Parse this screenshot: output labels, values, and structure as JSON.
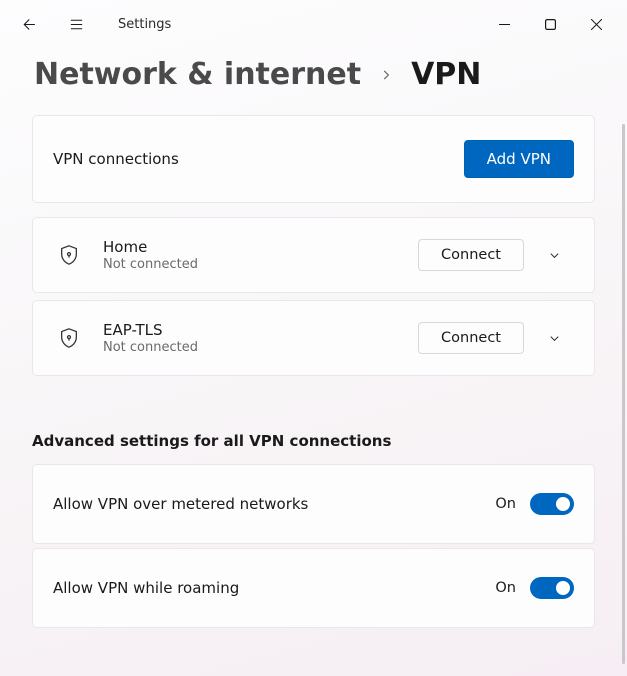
{
  "titlebar": {
    "title": "Settings"
  },
  "breadcrumb": {
    "parent": "Network & internet",
    "current": "VPN"
  },
  "vpn": {
    "header_label": "VPN connections",
    "add_button": "Add VPN",
    "connect_label": "Connect",
    "items": [
      {
        "name": "Home",
        "status": "Not connected"
      },
      {
        "name": "EAP-TLS",
        "status": "Not connected"
      }
    ]
  },
  "advanced": {
    "section_title": "Advanced settings for all VPN connections",
    "items": [
      {
        "label": "Allow VPN over metered networks",
        "state": "On",
        "on": true
      },
      {
        "label": "Allow VPN while roaming",
        "state": "On",
        "on": true
      }
    ]
  },
  "colors": {
    "accent": "#0067c0"
  }
}
